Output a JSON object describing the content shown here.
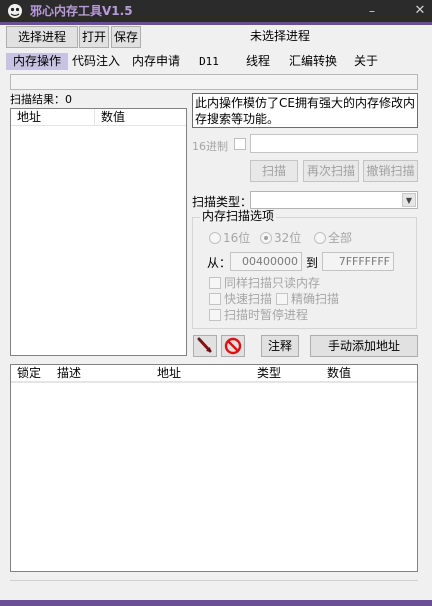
{
  "window": {
    "title": "邪心内存工具V1.5",
    "minimize_glyph": "–",
    "close_glyph": "✕",
    "accent_color": "#6a4e96"
  },
  "toolbar": {
    "select_process": "选择进程",
    "open": "打开",
    "save": "保存",
    "status": "未选择进程"
  },
  "tabs": [
    {
      "label": "内存操作",
      "active": true
    },
    {
      "label": "代码注入"
    },
    {
      "label": "内存申请"
    },
    {
      "label": "D11"
    },
    {
      "label": "线程"
    },
    {
      "label": "汇编转换"
    },
    {
      "label": "关于"
    }
  ],
  "scan": {
    "result_label": "扫描结果：0",
    "result_columns": [
      "地址",
      "数值"
    ],
    "info_text": "此内操作模仿了CE拥有强大的内存修改内存搜索等功能。",
    "hex_label": "16进制",
    "value_input": "",
    "buttons": {
      "scan": "扫描",
      "rescan": "再次扫描",
      "undo": "撤销扫描"
    },
    "type_label": "扫描类型：",
    "type_value": ""
  },
  "options": {
    "title": "内存扫描选项",
    "bits": [
      {
        "label": "16位",
        "checked": false
      },
      {
        "label": "32位",
        "checked": true
      },
      {
        "label": "全部",
        "checked": false
      }
    ],
    "from_label": "从：",
    "from_value": "00400000",
    "to_label": "到",
    "to_value": "7FFFFFFF",
    "checks": {
      "readonly": "同样扫描只读内存",
      "fast": "快速扫描",
      "precise": "精确扫描",
      "pause": "扫描时暂停进程"
    }
  },
  "actions": {
    "pick_icon": "pointer-pick-icon",
    "stop_icon": "stop-icon",
    "note": "注释",
    "add_address": "手动添加地址"
  },
  "address_list": {
    "columns": [
      "锁定",
      "描述",
      "地址",
      "类型",
      "数值"
    ]
  }
}
